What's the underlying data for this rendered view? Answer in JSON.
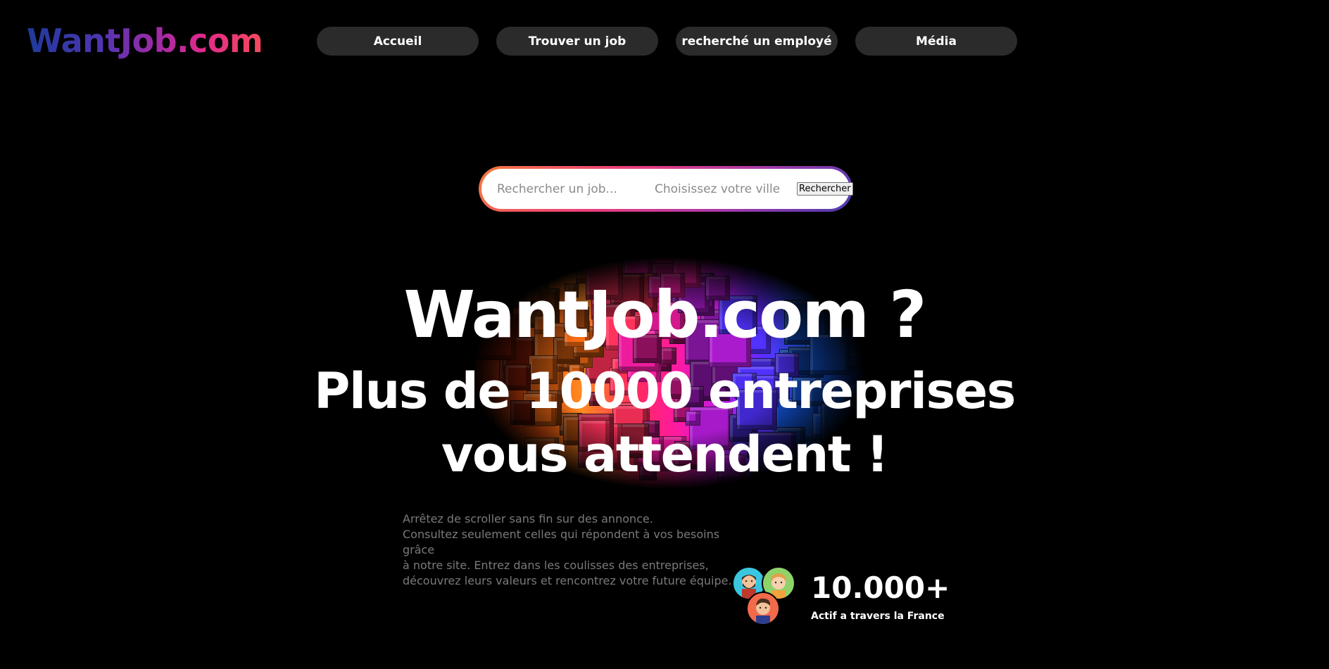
{
  "header": {
    "logo_text": "WantJob.com",
    "nav": [
      {
        "label": "Accueil"
      },
      {
        "label": "Trouver un job"
      },
      {
        "label": "recherché un employé"
      },
      {
        "label": "Média"
      }
    ]
  },
  "search": {
    "job_placeholder": "Rechercher un job...",
    "city_placeholder": "Choisissez votre ville",
    "button_label": "Rechercher"
  },
  "hero": {
    "title": "WantJob.com ?",
    "subtitle_line1": "Plus de 10000 entreprises",
    "subtitle_line2": "vous attendent !"
  },
  "description": {
    "lines": [
      "Arrêtez de scroller sans fin sur des annonce.",
      "Consultez seulement celles qui répondent à vos besoins grâce",
      "à notre site. Entrez dans les coulisses des entreprises,",
      "découvrez leurs valeurs et rencontrez votre future équipe."
    ]
  },
  "stats": {
    "number": "10.000+",
    "label": "Actif a travers la France"
  },
  "colors": {
    "background": "#000000",
    "nav_button": "#2b2b2b",
    "logo_gradient_start": "#1e3a9a",
    "logo_gradient_end": "#f34a5c",
    "description_text": "#7a7a7a"
  }
}
